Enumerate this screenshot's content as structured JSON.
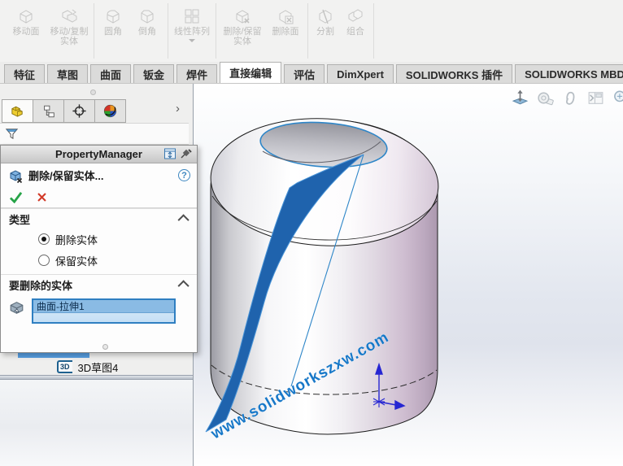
{
  "ribbon": {
    "groups": [
      {
        "buttons": [
          {
            "label": "移动面",
            "icon": "move-face-icon"
          },
          {
            "label": "移动/复制实体",
            "icon": "move-copy-body-icon"
          }
        ]
      },
      {
        "buttons": [
          {
            "label": "圆角",
            "icon": "fillet-icon"
          },
          {
            "label": "倒角",
            "icon": "chamfer-icon"
          }
        ]
      },
      {
        "buttons": [
          {
            "label": "线性阵列",
            "icon": "linear-pattern-icon",
            "has_dropdown": true
          }
        ]
      },
      {
        "buttons": [
          {
            "label": "删除/保留实体",
            "icon": "delete-keep-body-icon"
          },
          {
            "label": "删除面",
            "icon": "delete-face-icon"
          }
        ]
      },
      {
        "buttons": [
          {
            "label": "分割",
            "icon": "split-icon"
          },
          {
            "label": "组合",
            "icon": "combine-icon"
          }
        ]
      }
    ]
  },
  "command_tabs": {
    "items": [
      {
        "label": "特征",
        "active": false
      },
      {
        "label": "草图",
        "active": false
      },
      {
        "label": "曲面",
        "active": false
      },
      {
        "label": "钣金",
        "active": false
      },
      {
        "label": "焊件",
        "active": false
      },
      {
        "label": "直接编辑",
        "active": true
      },
      {
        "label": "评估",
        "active": false
      },
      {
        "label": "DimXpert",
        "active": false
      },
      {
        "label": "SOLIDWORKS 插件",
        "active": false
      },
      {
        "label": "SOLIDWORKS MBD",
        "active": false
      }
    ]
  },
  "left_panel": {
    "tabs": [
      "featuremanager",
      "configurationmanager",
      "dimxpertmanager",
      "displaymanager"
    ],
    "expand_arrow": "›",
    "property_manager": {
      "title": "PropertyManager",
      "feature": {
        "title": "删除/保留实体...",
        "help": "?"
      },
      "type_section": {
        "title": "类型",
        "options": [
          {
            "label": "删除实体",
            "selected": true
          },
          {
            "label": "保留实体",
            "selected": false
          }
        ]
      },
      "bodies_section": {
        "title": "要删除的实体",
        "items": [
          {
            "label": "曲面-拉伸1",
            "selected": true
          }
        ]
      }
    },
    "tree": {
      "icon_label": "3D",
      "item": "3D草图4"
    }
  },
  "viewport": {
    "watermark": "www.solidworkszxw.com",
    "hud_icons": [
      "view-normal-icon",
      "measure-icon",
      "attach-icon",
      "pane-icon",
      "magnifier-icon"
    ],
    "selected_body": "曲面-拉伸1"
  },
  "colors": {
    "accent_blue": "#2e86c8",
    "selected_surface_blue": "#1f63ad",
    "highlight_row_blue": "#8abbe4",
    "ok_green": "#27a448",
    "cancel_red": "#d23a28"
  }
}
